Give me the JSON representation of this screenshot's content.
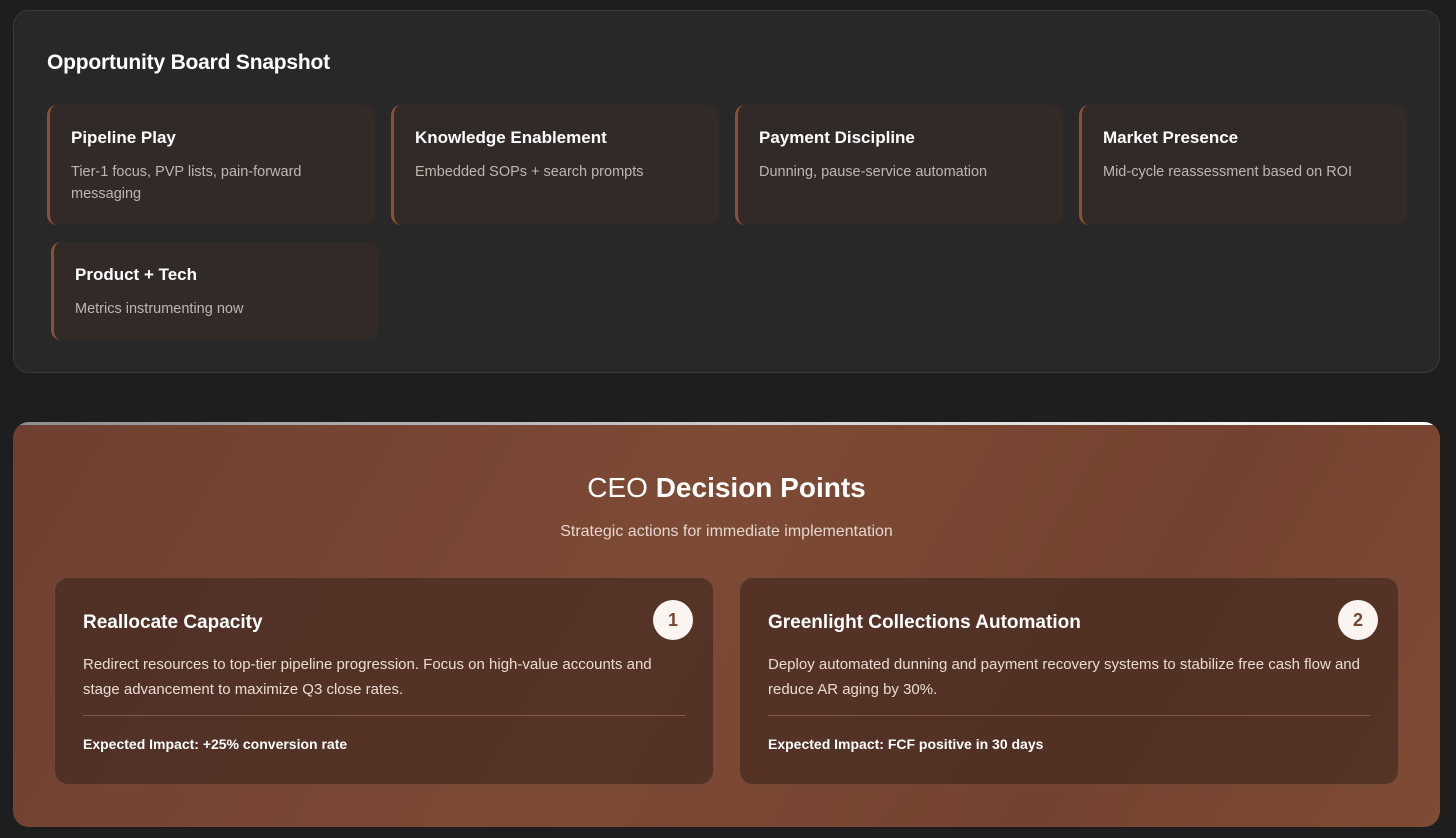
{
  "opportunity_board": {
    "title": "Opportunity Board Snapshot",
    "cards": [
      {
        "title": "Pipeline Play",
        "description": "Tier-1 focus, PVP lists, pain-forward messaging"
      },
      {
        "title": "Knowledge Enablement",
        "description": "Embedded SOPs + search prompts"
      },
      {
        "title": "Payment Discipline",
        "description": "Dunning, pause-service automation"
      },
      {
        "title": "Market Presence",
        "description": "Mid-cycle reassessment based on ROI"
      },
      {
        "title": "Product + Tech",
        "description": "Metrics instrumenting now"
      }
    ]
  },
  "decision_points": {
    "title_prefix": "CEO",
    "title_emphasis": "Decision Points",
    "subtitle": "Strategic actions for immediate implementation",
    "cards": [
      {
        "number": "1",
        "title": "Reallocate Capacity",
        "description": "Redirect resources to top-tier pipeline progression. Focus on high-value accounts and stage advancement to maximize Q3 close rates.",
        "impact": "Expected Impact: +25% conversion rate"
      },
      {
        "number": "2",
        "title": "Greenlight Collections Automation",
        "description": "Deploy automated dunning and payment recovery systems to stabilize free cash flow and reduce AR aging by 30%.",
        "impact": "Expected Impact: FCF positive in 30 days"
      }
    ]
  },
  "colors": {
    "page_background": "#1e1e1e",
    "board_background": "#282828",
    "card_background": "#312a27",
    "card_accent": "#8a5138",
    "decision_background": "#7a4733",
    "badge_background": "#fbf5f1",
    "badge_text": "#7a4330"
  }
}
